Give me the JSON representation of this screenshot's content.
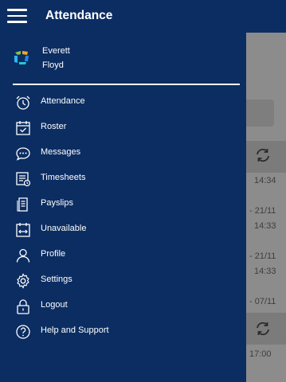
{
  "app_bar": {
    "title": "Attendance",
    "menu_icon": "hamburger-menu-icon"
  },
  "drawer": {
    "user": {
      "first_name": "Everett",
      "last_name": "Floyd",
      "logo_icon": "app-logo-icon"
    },
    "items": [
      {
        "label": "Attendance",
        "icon": "alarm-clock-icon"
      },
      {
        "label": "Roster",
        "icon": "calendar-check-icon"
      },
      {
        "label": "Messages",
        "icon": "chat-bubble-icon"
      },
      {
        "label": "Timesheets",
        "icon": "timesheet-icon"
      },
      {
        "label": "Payslips",
        "icon": "payslip-icon"
      },
      {
        "label": "Unavailable",
        "icon": "calendar-range-icon"
      },
      {
        "label": "Profile",
        "icon": "person-icon"
      },
      {
        "label": "Settings",
        "icon": "gear-icon"
      },
      {
        "label": "Logout",
        "icon": "lock-icon"
      },
      {
        "label": "Help and Support",
        "icon": "help-icon"
      }
    ]
  },
  "background": {
    "times": [
      "14:34",
      "- 21/11",
      "14:33",
      "- 21/11",
      "14:33",
      "- 07/11",
      "17:00"
    ]
  },
  "colors": {
    "primary": "#0b2d62",
    "text": "#ffffff",
    "scrim": "#8c8c8c"
  }
}
